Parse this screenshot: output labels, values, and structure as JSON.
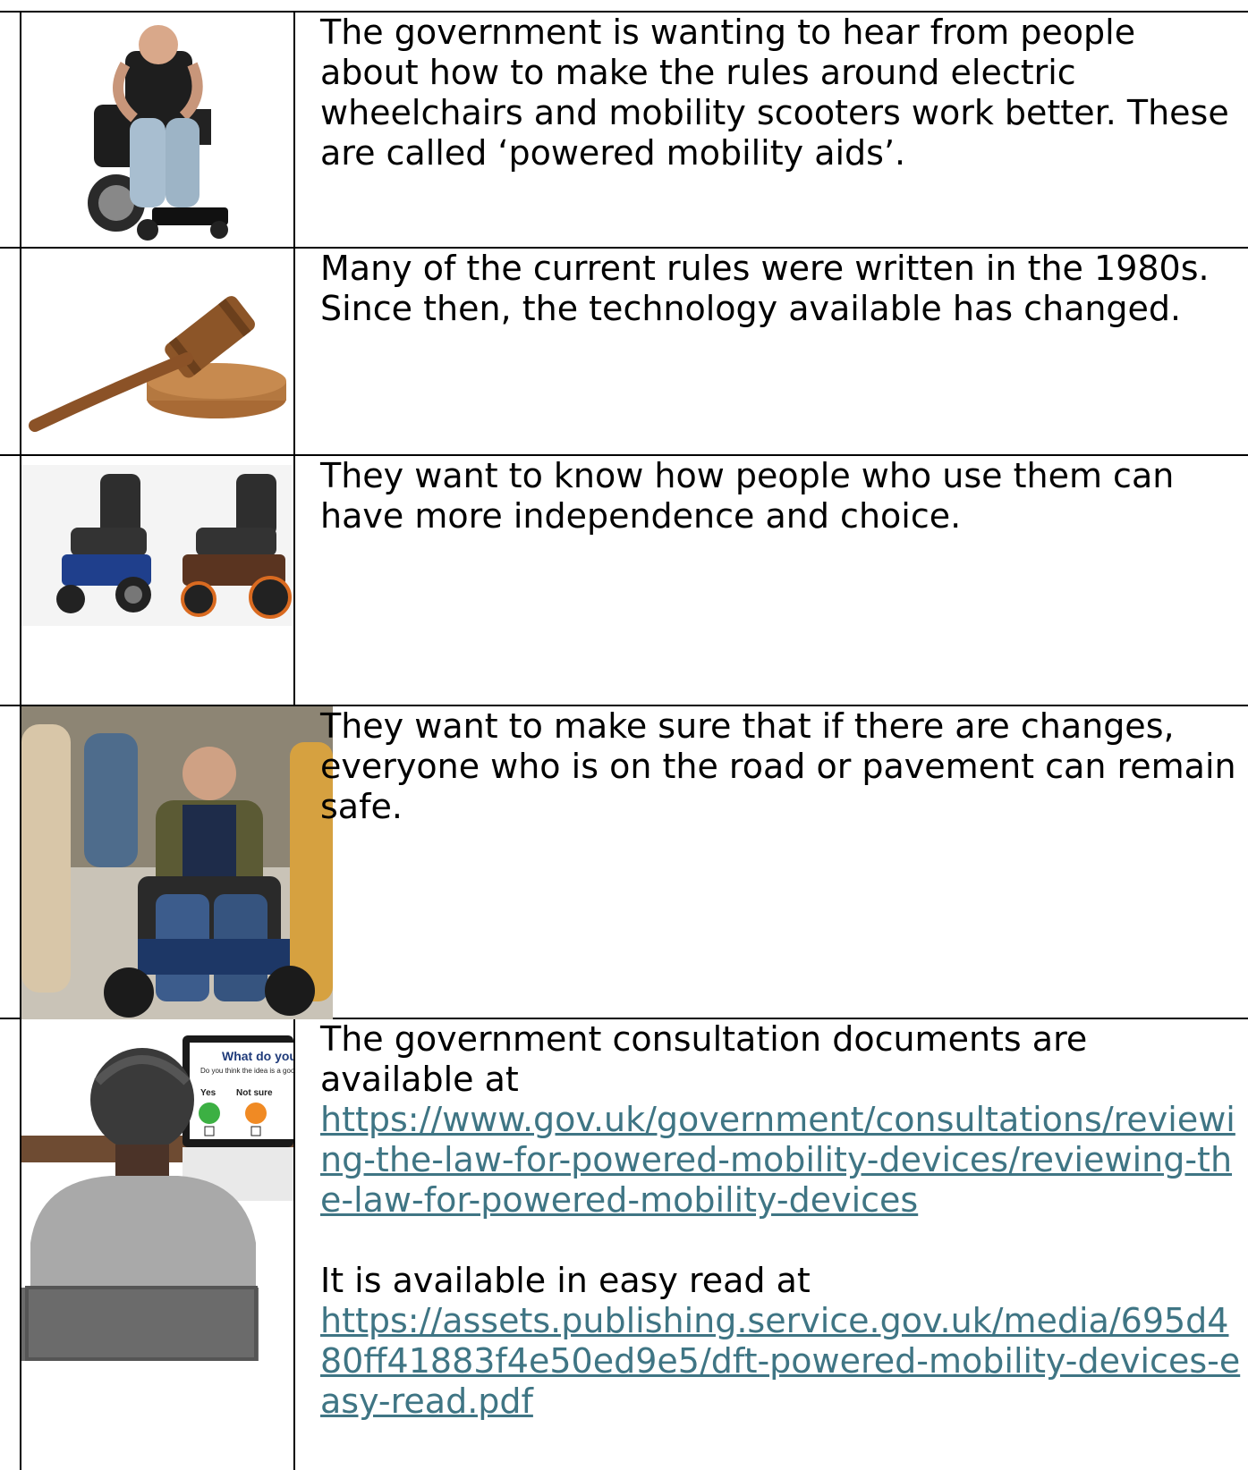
{
  "rows": [
    {
      "icon": "wheelchair-user-icon",
      "text": "The government is wanting to hear from people about how to make the rules around electric wheelchairs and mobility scooters work better. These are called ‘powered mobility aids’."
    },
    {
      "icon": "gavel-icon",
      "text": "Many of the current rules were written in the 1980s. Since then, the technology available has changed."
    },
    {
      "icon": "powered-wheelchairs-icon",
      "text": "They want to know how people who use them can have more independence and choice."
    },
    {
      "icon": "street-wheelchair-icon",
      "text": "They want to make sure that if there are changes, everyone who is on the road or pavement can remain safe."
    },
    {
      "icon": "survey-computer-icon",
      "text": "The government consultation documents are available at",
      "link1": "https://www.gov.uk/government/consultations/reviewing-the-law-for-powered-mobility-devices/reviewing-the-law-for-powered-mobility-devices",
      "text2": "It is available in easy read at",
      "link2": "https://assets.publishing.service.gov.uk/media/695d480ff41883f4e50ed9e5/dft-powered-mobility-devices-easy-read.pdf",
      "screen": {
        "title": "What do you",
        "question": "Do you think the idea is a good one?",
        "yes": "Yes",
        "not_sure": "Not sure"
      }
    }
  ]
}
